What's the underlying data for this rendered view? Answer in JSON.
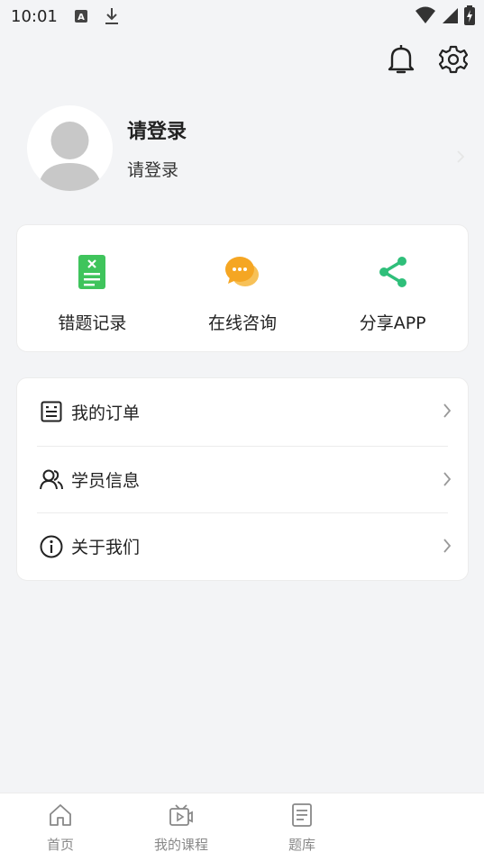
{
  "status_bar": {
    "time": "10:01",
    "icons": [
      "notification-a-icon",
      "download-icon",
      "wifi-icon",
      "signal-icon",
      "battery-icon"
    ]
  },
  "top_actions": {
    "icons": [
      "bell-icon",
      "gear-icon"
    ]
  },
  "profile": {
    "name": "请登录",
    "subtitle": "请登录"
  },
  "quick_actions": [
    {
      "label": "错题记录",
      "icon": "wrong-answers-doc-icon",
      "color": "#3fc45c"
    },
    {
      "label": "在线咨询",
      "icon": "chat-bubble-icon",
      "color": "#f5b531"
    },
    {
      "label": "分享APP",
      "icon": "share-icon",
      "color": "#2fbf7a"
    }
  ],
  "menu": [
    {
      "label": "我的订单",
      "icon": "order-list-icon"
    },
    {
      "label": "学员信息",
      "icon": "students-icon"
    },
    {
      "label": "关于我们",
      "icon": "info-icon"
    }
  ],
  "bottom_nav": [
    {
      "label": "首页",
      "icon": "home-icon"
    },
    {
      "label": "我的课程",
      "icon": "video-course-icon"
    },
    {
      "label": "题库",
      "icon": "question-bank-icon"
    }
  ],
  "colors": {
    "background": "#f3f4f6",
    "card": "#ffffff",
    "text": "#222222",
    "nav_inactive": "#888888"
  }
}
